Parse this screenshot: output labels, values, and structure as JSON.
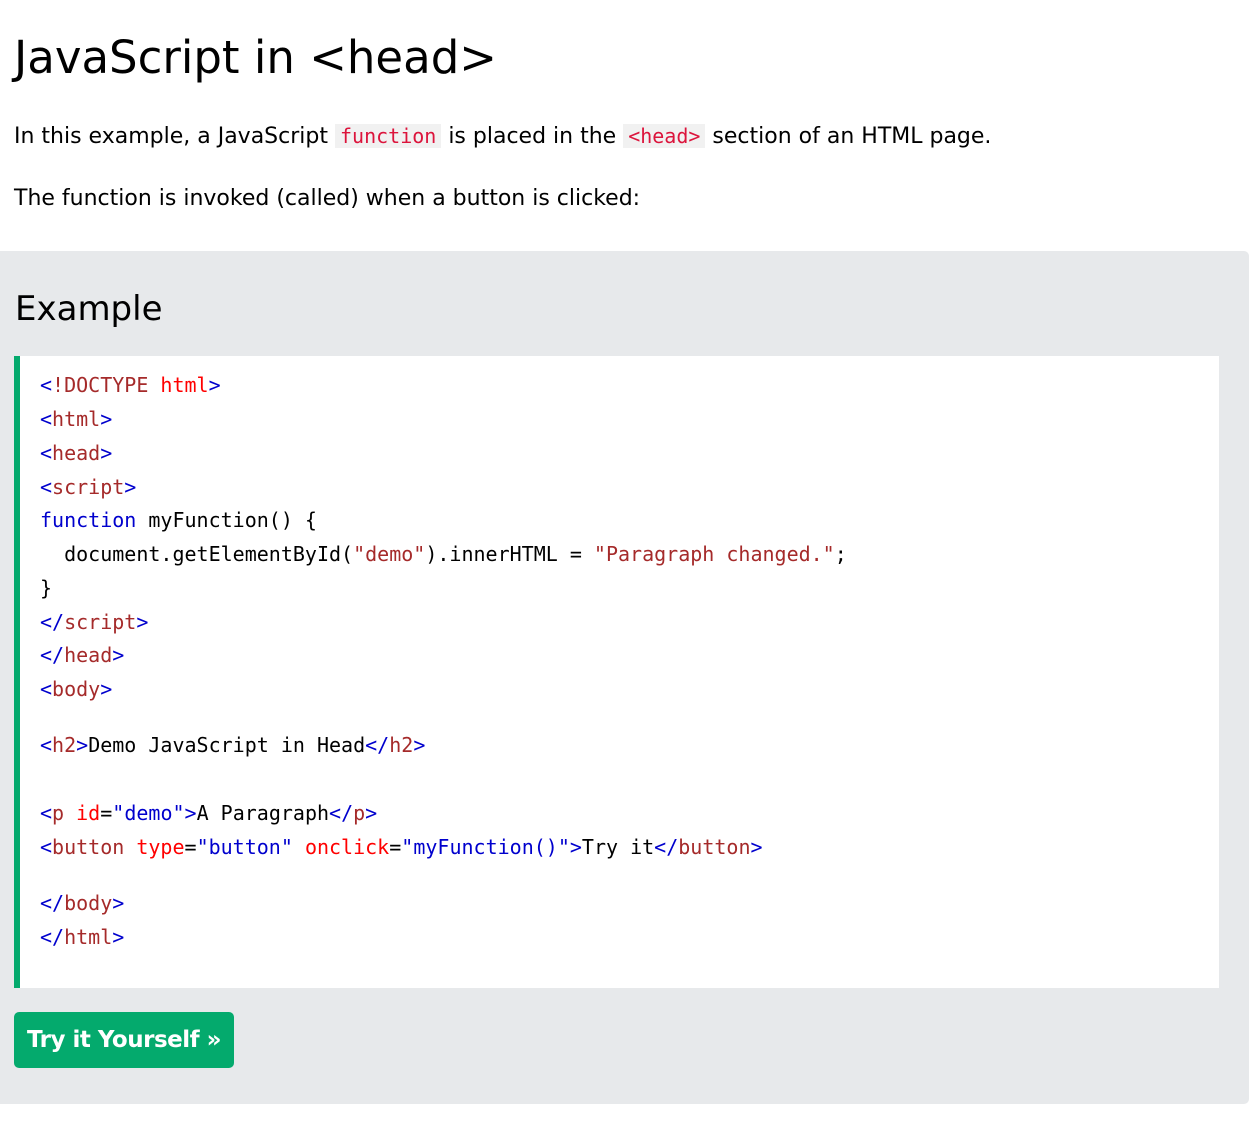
{
  "page": {
    "title": "JavaScript in <head>",
    "intro": {
      "before": "In this example, a JavaScript ",
      "code1": "function",
      "middle": " is placed in the ",
      "code2": "<head>",
      "after": " section of an HTML page."
    },
    "invoked_text": "The function is invoked (called) when a button is clicked:"
  },
  "example": {
    "heading": "Example",
    "code": {
      "l1": {
        "open": "<",
        "name": "!DOCTYPE",
        "space": " ",
        "attr": "html",
        "close": ">"
      },
      "l2": {
        "open": "<",
        "name": "html",
        "close": ">"
      },
      "l3": {
        "open": "<",
        "name": "head",
        "close": ">"
      },
      "l4": {
        "open": "<",
        "name": "script",
        "close": ">"
      },
      "l5": {
        "kw": "function",
        "rest": " myFunction() {"
      },
      "l6": {
        "a": "  document.getElementById(",
        "s1": "\"demo\"",
        "b": ").innerHTML = ",
        "s2": "\"Paragraph changed.\"",
        "c": ";"
      },
      "l7": {
        "text": "}"
      },
      "l8": {
        "open": "</",
        "name": "script",
        "close": ">"
      },
      "l9": {
        "open": "</",
        "name": "head",
        "close": ">"
      },
      "l10": {
        "open": "<",
        "name": "body",
        "close": ">"
      },
      "l11": {
        "open1": "<",
        "name1": "h2",
        "close1": ">",
        "text": "Demo JavaScript in Head",
        "open2": "</",
        "name2": "h2",
        "close2": ">"
      },
      "l12": {
        "open1": "<",
        "name1": "p",
        "sp": " ",
        "attr": "id",
        "eq": "=",
        "val": "\"demo\"",
        "close1": ">",
        "text": "A Paragraph",
        "open2": "</",
        "name2": "p",
        "close2": ">"
      },
      "l13": {
        "open1": "<",
        "name1": "button",
        "sp1": " ",
        "attr1": "type",
        "eq1": "=",
        "val1": "\"button\"",
        "sp2": " ",
        "attr2": "onclick",
        "eq2": "=",
        "val2": "\"myFunction()\"",
        "close1": ">",
        "text": "Try it",
        "open2": "</",
        "name2": "button",
        "close2": ">"
      },
      "l14": {
        "open": "</",
        "name": "body",
        "close": ">"
      },
      "l15": {
        "open": "</",
        "name": "html",
        "close": ">"
      }
    },
    "button_label": "Try it Yourself »"
  },
  "colors": {
    "accent_green": "#04aa6d",
    "panel_bg": "#e7e9eb",
    "inline_code": "#dc143c",
    "tag_blue": "#0000cd",
    "tag_name_brown": "#a52a2a",
    "attr_red": "#ff0000"
  }
}
